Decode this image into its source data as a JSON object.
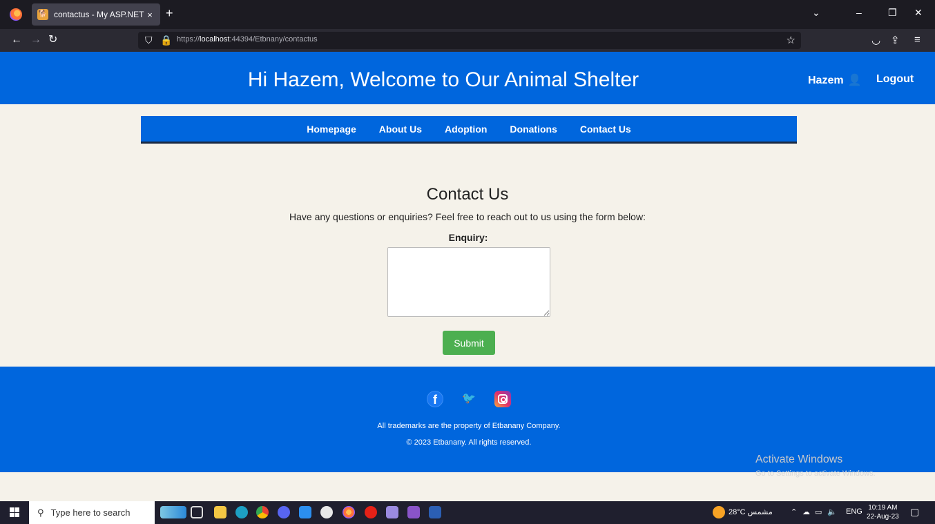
{
  "browser": {
    "tab_title": "contactus - My ASP.NET Applic",
    "tab_close": "×",
    "new_tab": "+",
    "url_prefix": "https://",
    "url_host": "localhost",
    "url_rest": ":44394/Etbnany/contactus"
  },
  "header": {
    "title": "Hi Hazem, Welcome to Our Animal Shelter",
    "user_name": "Hazem",
    "logout_label": "Logout"
  },
  "nav": {
    "items": [
      "Homepage",
      "About Us",
      "Adoption",
      "Donations",
      "Contact Us"
    ]
  },
  "contact": {
    "title": "Contact Us",
    "subtitle": "Have any questions or enquiries? Feel free to reach out to us using the form below:",
    "enquiry_label": "Enquiry:",
    "enquiry_value": "",
    "submit_label": "Submit"
  },
  "footer": {
    "trademark": "All trademarks are the property of Etbanany Company.",
    "copyright": "© 2023 Etbanany. All rights reserved."
  },
  "watermark": {
    "line1": "Activate Windows",
    "line2": "Go to Settings to activate Windows."
  },
  "taskbar": {
    "search_placeholder": "Type here to search",
    "weather": "28°C مشمس",
    "lang": "ENG",
    "time": "10:19 AM",
    "date": "22-Aug-23"
  },
  "colors": {
    "brand_blue": "#0066dd",
    "submit_green": "#4caf50",
    "page_bg": "#f5f2ea"
  }
}
